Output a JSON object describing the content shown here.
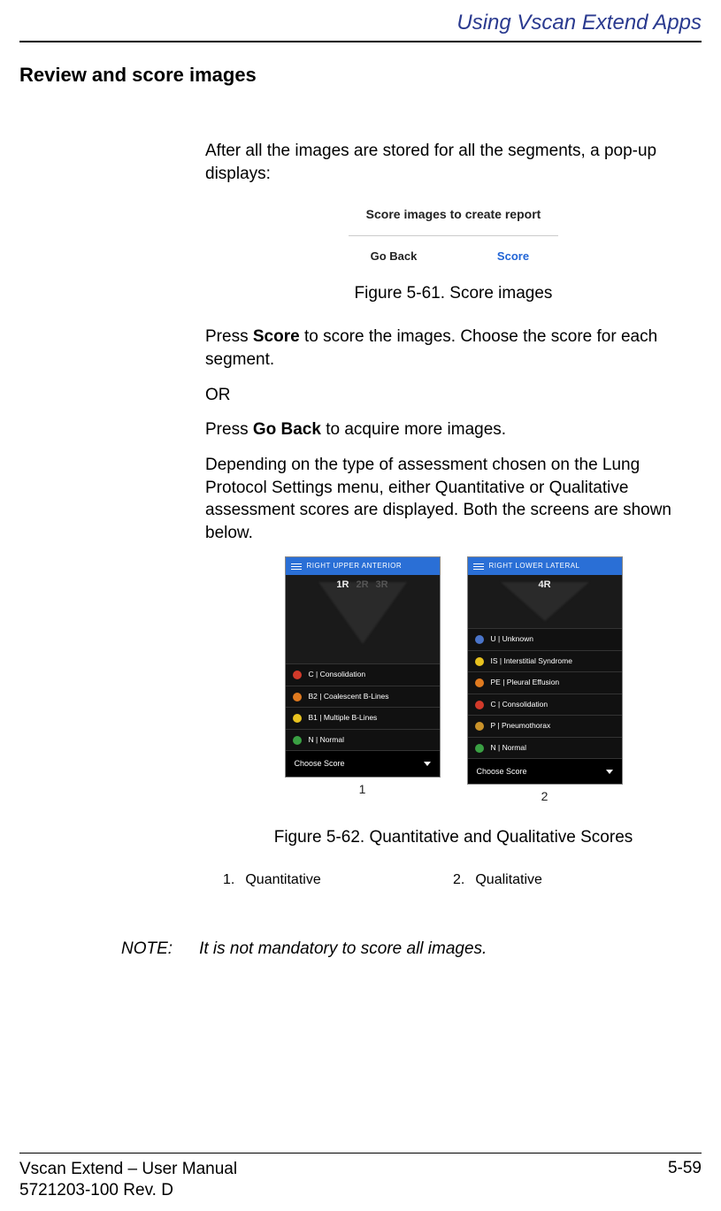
{
  "header": {
    "chapter": "Using Vscan Extend Apps"
  },
  "section_title": "Review and score images",
  "body": {
    "intro": "After all the images are stored for all the segments, a pop-up displays:",
    "press_score_pre": "Press ",
    "press_score_bold": "Score",
    "press_score_post": " to score the images. Choose the score for each segment.",
    "or": "OR",
    "press_goback_pre": "Press ",
    "press_goback_bold": "Go Back",
    "press_goback_post": " to acquire more images.",
    "depending": "Depending on the type of assessment chosen on the Lung Protocol Settings menu, either Quantitative or Qualitative assessment scores are displayed. Both the screens are shown below."
  },
  "fig61": {
    "popup_title": "Score images to create report",
    "goback": "Go Back",
    "score": "Score",
    "caption": "Figure 5-61.    Score images"
  },
  "fig62": {
    "caption": "Figure 5-62.    Quantitative and Qualitative Scores",
    "screen1": {
      "title": "RIGHT UPPER ANTERIOR",
      "segs": [
        "1R",
        "2R",
        "3R"
      ],
      "rows": [
        {
          "color": "#d23a2a",
          "label": "C | Consolidation"
        },
        {
          "color": "#e07a1f",
          "label": "B2 | Coalescent B-Lines"
        },
        {
          "color": "#e8c21f",
          "label": "B1 | Multiple B-Lines"
        },
        {
          "color": "#3aa043",
          "label": "N | Normal"
        }
      ],
      "choose": "Choose Score",
      "num": "1"
    },
    "screen2": {
      "title": "RIGHT LOWER LATERAL",
      "segs": [
        "4R"
      ],
      "rows": [
        {
          "color": "#4a74c9",
          "label": "U | Unknown"
        },
        {
          "color": "#e8c21f",
          "label": "IS | Interstitial Syndrome"
        },
        {
          "color": "#e07a1f",
          "label": "PE | Pleural Effusion"
        },
        {
          "color": "#d23a2a",
          "label": "C | Consolidation"
        },
        {
          "color": "#c9922a",
          "label": "P | Pneumothorax"
        },
        {
          "color": "#3aa043",
          "label": "N | Normal"
        }
      ],
      "choose": "Choose Score",
      "num": "2"
    },
    "legend": {
      "n1": "1.",
      "l1": "Quantitative",
      "n2": "2.",
      "l2": "Qualitative"
    }
  },
  "note": {
    "label": "NOTE:",
    "text": "It is not mandatory to score all images."
  },
  "footer": {
    "line1": "Vscan Extend – User Manual",
    "line2": "5721203-100 Rev. D",
    "page": "5-59"
  }
}
